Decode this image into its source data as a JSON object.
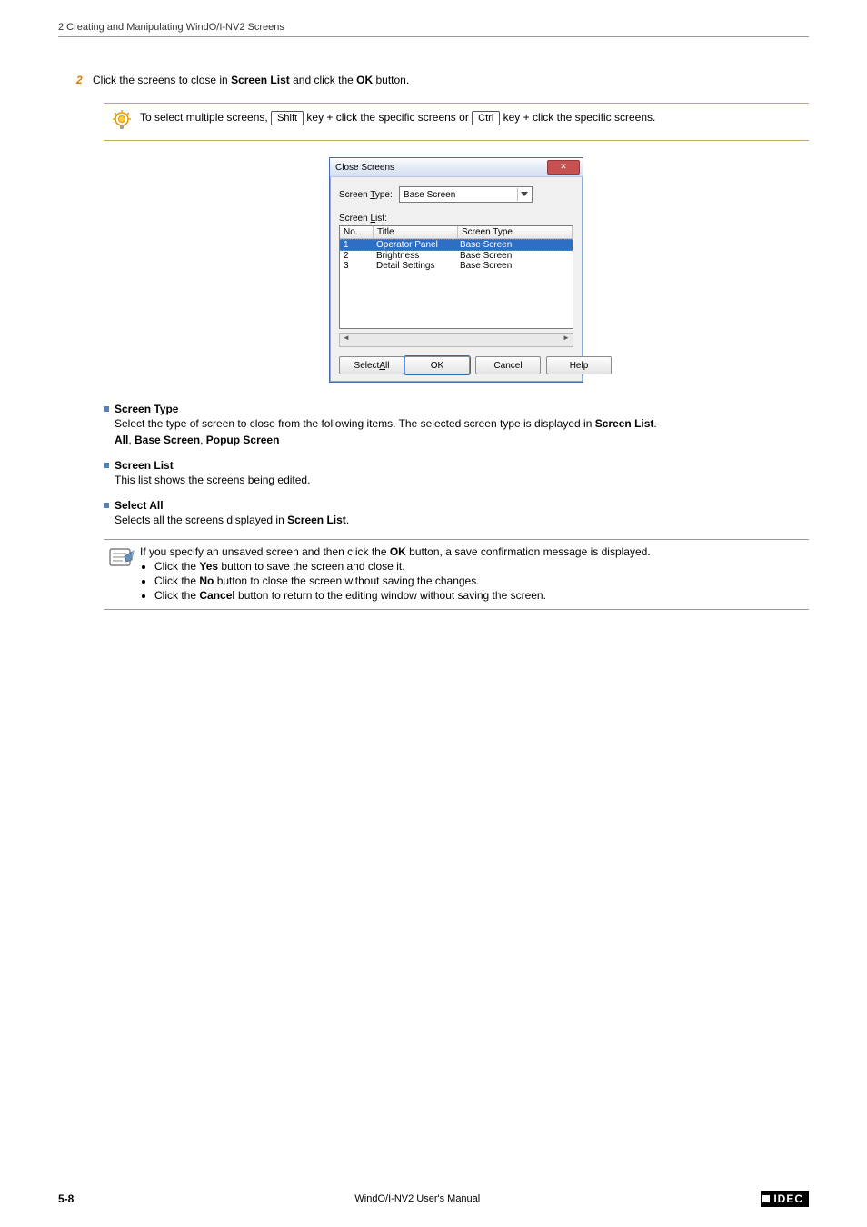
{
  "header": "2 Creating and Manipulating WindO/I-NV2 Screens",
  "step": {
    "num": "2",
    "pre": "Click the screens to close in ",
    "b1": "Screen List",
    "mid": " and click the ",
    "b2": "OK",
    "post": " button."
  },
  "tip": {
    "pre": "To select multiple screens, ",
    "k1": "Shift",
    "mid1": " key + click the specific screens or ",
    "k2": "Ctrl",
    "post": " key + click the specific screens."
  },
  "dialog": {
    "title": "Close Screens",
    "type_label_pre": "Screen ",
    "type_label_u": "T",
    "type_label_post": "ype:",
    "type_value": "Base Screen",
    "list_label_pre": "Screen ",
    "list_label_u": "L",
    "list_label_post": "ist:",
    "cols": {
      "no": "No.",
      "title": "Title",
      "type": "Screen Type"
    },
    "rows": [
      {
        "no": "1",
        "title": "Operator Panel",
        "type": "Base Screen",
        "sel": true
      },
      {
        "no": "2",
        "title": "Brightness",
        "type": "Base Screen",
        "sel": false
      },
      {
        "no": "3",
        "title": "Detail Settings",
        "type": "Base Screen",
        "sel": false
      }
    ],
    "btn_selectall_pre": "Select ",
    "btn_selectall_u": "A",
    "btn_selectall_post": "ll",
    "btn_ok": "OK",
    "btn_cancel": "Cancel",
    "btn_help": "Help"
  },
  "sec_type": {
    "head": "Screen Type",
    "line_pre": "Select the type of screen to close from the following items. The selected screen type is displayed in ",
    "line_b": "Screen List",
    "line_post": ".",
    "opts_b1": "All",
    "sep1": ", ",
    "opts_b2": "Base Screen",
    "sep2": ", ",
    "opts_b3": "Popup Screen"
  },
  "sec_list": {
    "head": "Screen List",
    "body": "This list shows the screens being edited."
  },
  "sec_selall": {
    "head": "Select All",
    "pre": "Selects all the screens displayed in ",
    "b": "Screen List",
    "post": "."
  },
  "note": {
    "line1_pre": "If you specify an unsaved screen and then click the ",
    "line1_b": "OK",
    "line1_post": " button, a save confirmation message is displayed.",
    "li1_pre": "Click the ",
    "li1_b": "Yes",
    "li1_post": " button to save the screen and close it.",
    "li2_pre": "Click the ",
    "li2_b": "No",
    "li2_post": " button to close the screen without saving the changes.",
    "li3_pre": "Click the ",
    "li3_b": "Cancel",
    "li3_post": " button to return to the editing window without saving the screen."
  },
  "footer": {
    "page": "5-8",
    "center": "WindO/I-NV2 User's Manual",
    "logo": "IDEC"
  }
}
